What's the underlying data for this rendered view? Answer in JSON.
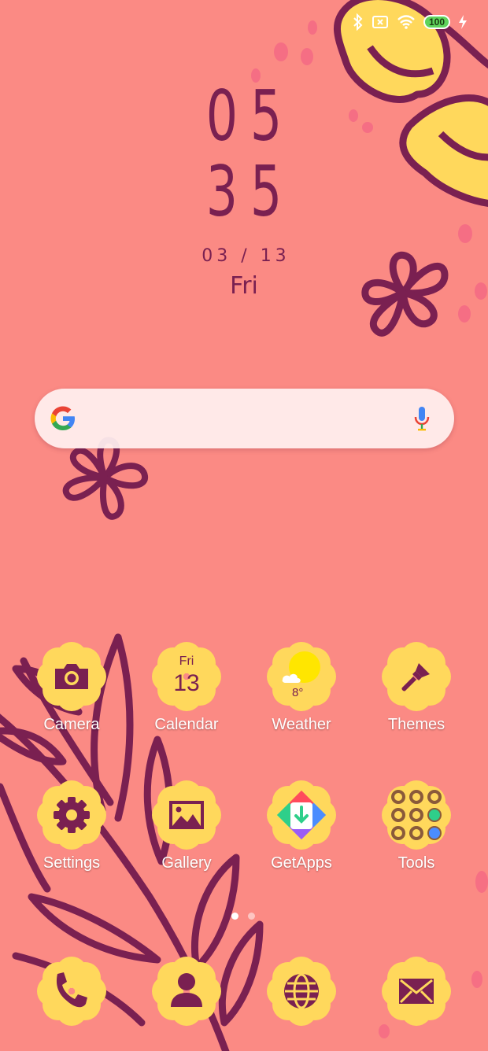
{
  "status_bar": {
    "icons": [
      "bluetooth-icon",
      "no-sim-icon",
      "wifi-icon",
      "battery-icon",
      "charging-icon"
    ],
    "battery": "100"
  },
  "clock": {
    "hours": "05",
    "minutes": "35",
    "date": "03 / 13",
    "day": "Fri"
  },
  "search": {
    "icons": [
      "google-logo",
      "mic-icon"
    ]
  },
  "apps": [
    {
      "label": "Camera",
      "icon": "camera-icon"
    },
    {
      "label": "Calendar",
      "icon": "calendar-icon",
      "day": "Fri",
      "date": "13"
    },
    {
      "label": "Weather",
      "icon": "weather-icon",
      "temp": "8°"
    },
    {
      "label": "Themes",
      "icon": "paintbrush-icon"
    },
    {
      "label": "Settings",
      "icon": "gear-icon"
    },
    {
      "label": "Gallery",
      "icon": "image-icon"
    },
    {
      "label": "GetApps",
      "icon": "getapps-icon"
    },
    {
      "label": "Tools",
      "icon": "tools-folder-icon"
    }
  ],
  "dock": [
    {
      "icon": "phone-icon"
    },
    {
      "icon": "contacts-icon"
    },
    {
      "icon": "browser-icon"
    },
    {
      "icon": "messages-icon"
    }
  ],
  "pager": {
    "pages": 2,
    "current": 1
  },
  "colors": {
    "background": "#fb8a84",
    "flower": "#ffd85c",
    "line": "#7a2051",
    "spot": "#f56b84"
  }
}
